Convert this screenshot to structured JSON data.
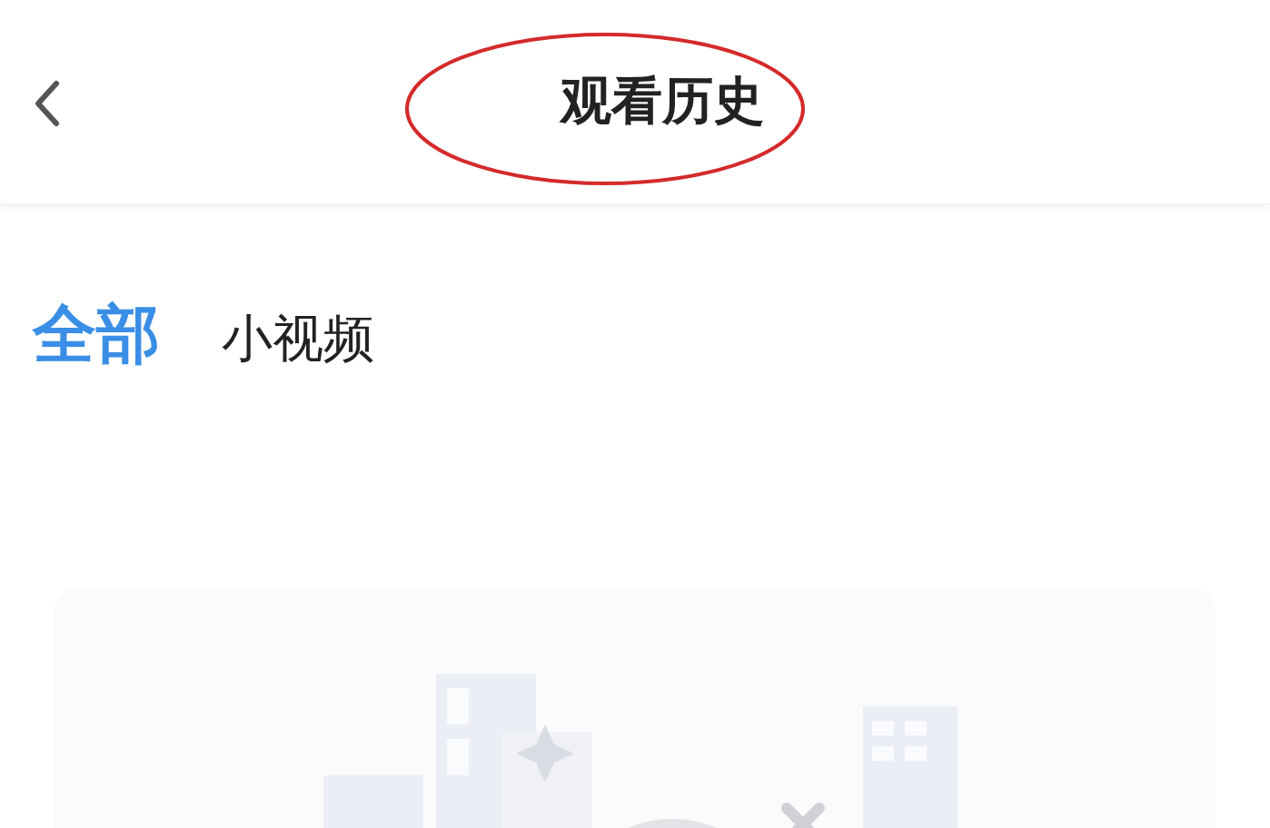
{
  "header": {
    "title": "观看历史"
  },
  "tabs": [
    {
      "label": "全部",
      "selected": true
    },
    {
      "label": "小视频",
      "selected": false
    }
  ]
}
